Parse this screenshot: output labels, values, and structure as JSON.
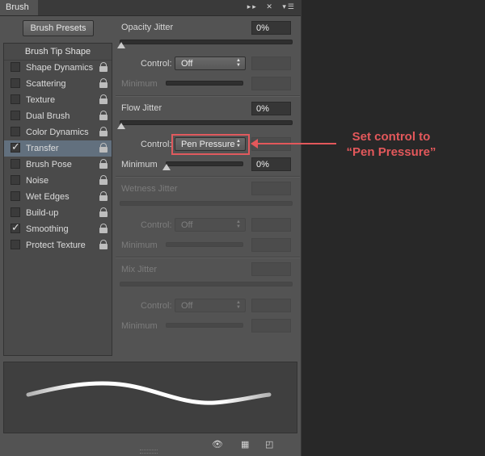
{
  "panel": {
    "tab_label": "Brush",
    "presets_button": "Brush Presets",
    "tip_shape": "Brush Tip Shape",
    "items": [
      {
        "label": "Shape Dynamics",
        "checked": false,
        "selected": false
      },
      {
        "label": "Scattering",
        "checked": false,
        "selected": false
      },
      {
        "label": "Texture",
        "checked": false,
        "selected": false
      },
      {
        "label": "Dual Brush",
        "checked": false,
        "selected": false
      },
      {
        "label": "Color Dynamics",
        "checked": false,
        "selected": false
      },
      {
        "label": "Transfer",
        "checked": true,
        "selected": true
      },
      {
        "label": "Brush Pose",
        "checked": false,
        "selected": false
      },
      {
        "label": "Noise",
        "checked": false,
        "selected": false
      },
      {
        "label": "Wet Edges",
        "checked": false,
        "selected": false
      },
      {
        "label": "Build-up",
        "checked": false,
        "selected": false
      },
      {
        "label": "Smoothing",
        "checked": true,
        "selected": false
      },
      {
        "label": "Protect Texture",
        "checked": false,
        "selected": false
      }
    ]
  },
  "opacity": {
    "label": "Opacity Jitter",
    "value": "0%",
    "control_label": "Control:",
    "control_value": "Off",
    "minimum_label": "Minimum"
  },
  "flow": {
    "label": "Flow Jitter",
    "value": "0%",
    "control_label": "Control:",
    "control_value": "Pen Pressure",
    "minimum_label": "Minimum",
    "minimum_value": "0%"
  },
  "wetness": {
    "label": "Wetness Jitter",
    "control_label": "Control:",
    "control_value": "Off",
    "minimum_label": "Minimum"
  },
  "mix": {
    "label": "Mix Jitter",
    "control_label": "Control:",
    "control_value": "Off",
    "minimum_label": "Minimum"
  },
  "annotation": {
    "line1": "Set control to",
    "line2": "“Pen Pressure”",
    "color": "#e3585b"
  },
  "icons": [
    "double-arrow-icon",
    "close-icon",
    "panel-menu-icon",
    "eye-icon",
    "grid-icon",
    "new-preset-icon",
    "lock-icon"
  ]
}
